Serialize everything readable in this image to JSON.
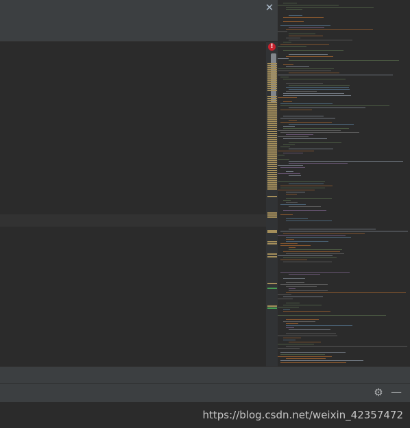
{
  "window": {
    "close_glyph": "✕",
    "error_glyph": "!"
  },
  "tool_window": {
    "settings_glyph": "⚙",
    "minimize_glyph": "—"
  },
  "watermark": "https://blog.csdn.net/weixin_42357472",
  "colors": {
    "background": "#2b2b2b",
    "panel": "#3c3f41",
    "gutter": "#313335",
    "error": "#c7222d",
    "warning_mark": "#a58f5b",
    "info_mark": "#499c54"
  },
  "icons": {
    "close": "close-icon",
    "error": "error-icon",
    "settings": "gear-icon",
    "minimize": "minimize-icon"
  }
}
